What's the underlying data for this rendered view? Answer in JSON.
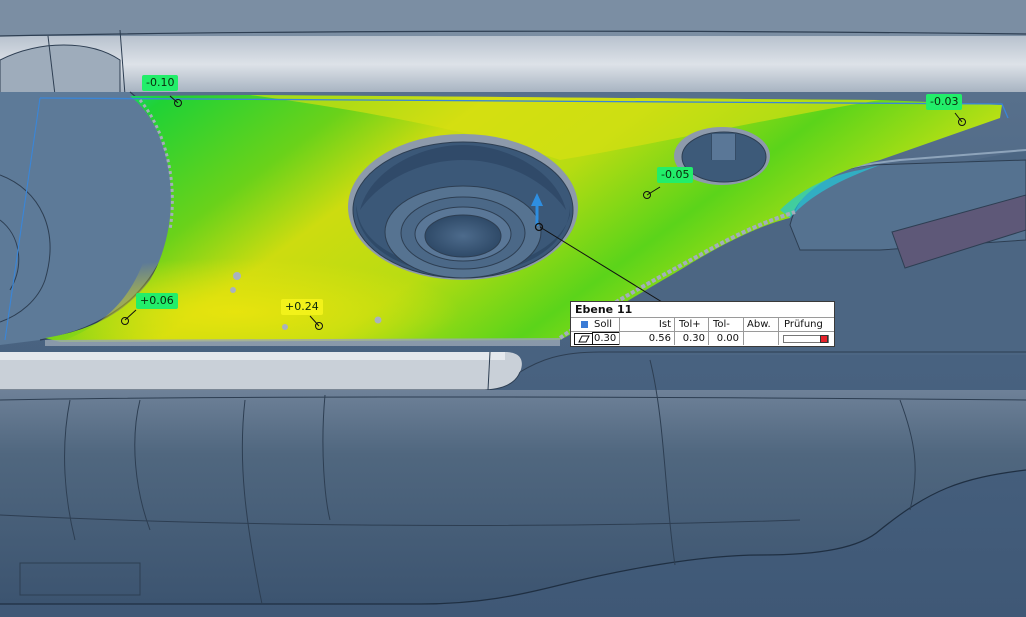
{
  "colors": {
    "background": "#f4f4f5",
    "model_blue": "#4b6784",
    "deviation_green": "#22ee6a",
    "deviation_yellow": "#f2f21a",
    "check_fail": "#e5222a"
  },
  "deviation_labels": [
    {
      "id": "dev-1",
      "text": "-0.10",
      "color": "green"
    },
    {
      "id": "dev-2",
      "text": "-0.03",
      "color": "green"
    },
    {
      "id": "dev-3",
      "text": "-0.05",
      "color": "green"
    },
    {
      "id": "dev-4",
      "text": "+0.06",
      "color": "green"
    },
    {
      "id": "dev-5",
      "text": "+0.24",
      "color": "yellow"
    }
  ],
  "inspection_table": {
    "title": "Ebene 11",
    "headers": {
      "soll": "Soll",
      "ist": "Ist",
      "tol_plus": "Tol+",
      "tol_minus": "Tol-",
      "abw": "Abw.",
      "pruefung": "Prüfung"
    },
    "row": {
      "soll": "0.30",
      "ist": "0.56",
      "tol_plus": "0.30",
      "tol_minus": "0.00",
      "abw": ""
    },
    "feature_icon": "flatness-icon",
    "check_status": "fail"
  }
}
